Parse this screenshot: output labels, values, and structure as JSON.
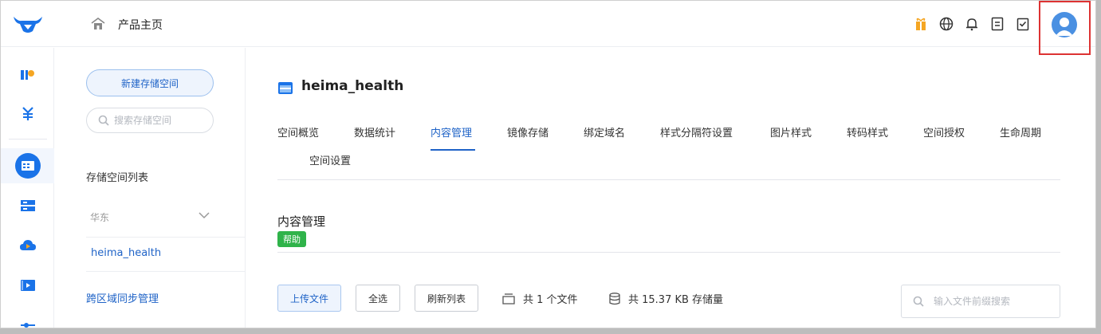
{
  "header": {
    "home_title": "产品主页"
  },
  "top_icons": [
    "gift-icon",
    "globe-icon",
    "bell-icon",
    "document-icon",
    "checklist-icon",
    "avatar"
  ],
  "rail_icons": [
    "kodo-logo-icon",
    "billing-icon",
    "storage-icon",
    "server-icon",
    "cloud-icon",
    "media-icon",
    "settings-slider-icon"
  ],
  "sidebar": {
    "new_button": "新建存储空间",
    "search_placeholder": "搜索存储空间",
    "list_heading": "存储空间列表",
    "region": "华东",
    "bucket": "heima_health",
    "cross_region": "跨区域同步管理"
  },
  "main": {
    "bucket_name": "heima_health",
    "tabs": [
      {
        "label": "空间概览"
      },
      {
        "label": "数据统计"
      },
      {
        "label": "内容管理",
        "active": true
      },
      {
        "label": "镜像存储"
      },
      {
        "label": "绑定域名"
      },
      {
        "label": "样式分隔符设置"
      },
      {
        "label": "图片样式"
      },
      {
        "label": "转码样式"
      },
      {
        "label": "空间授权"
      },
      {
        "label": "生命周期"
      },
      {
        "label": "空间设置"
      }
    ],
    "section_title": "内容管理",
    "help_label": "帮助",
    "toolbar": {
      "upload": "上传文件",
      "select_all": "全选",
      "refresh": "刷新列表"
    },
    "file_count": "共 1 个文件",
    "storage_used": "共 15.37 KB 存储量",
    "search_placeholder": "输入文件前缀搜索"
  },
  "colors": {
    "accent": "#1f63c7",
    "help_green": "#2fb34a",
    "highlight_red": "#dd3333"
  }
}
